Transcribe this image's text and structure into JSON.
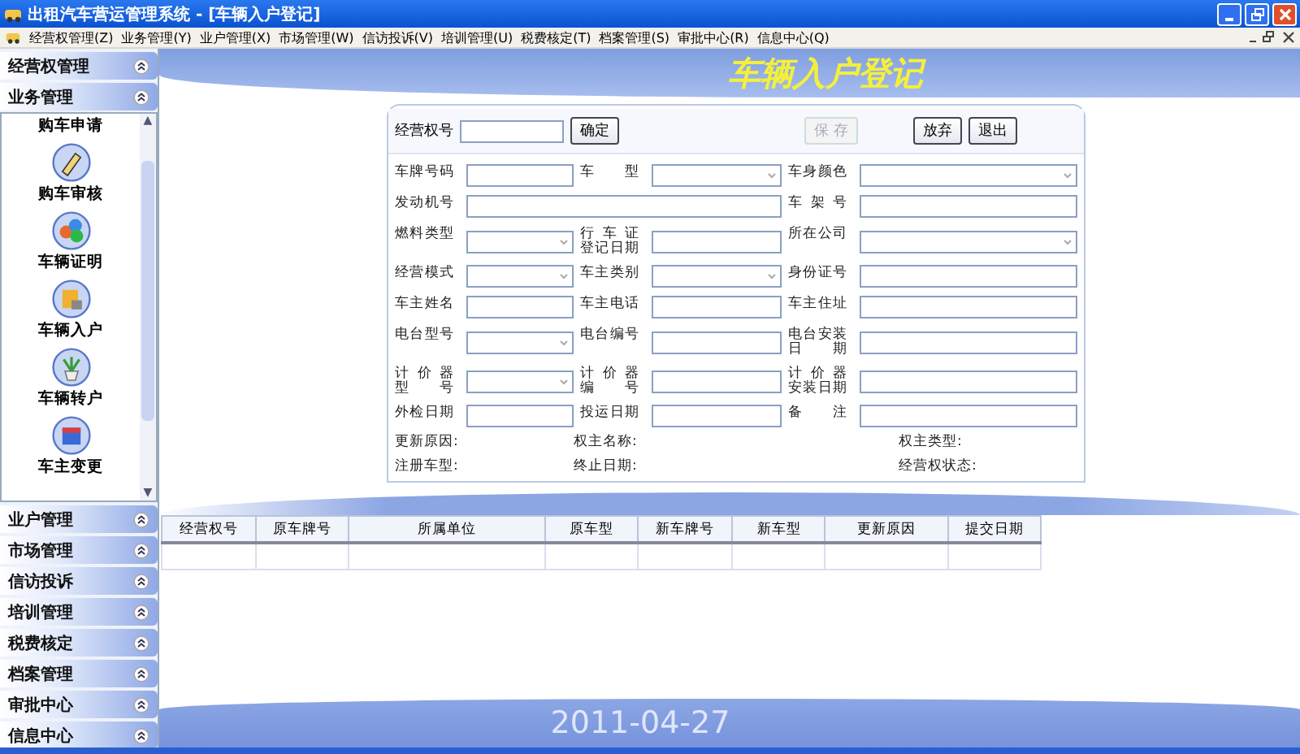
{
  "window": {
    "title": "出租汽车营运管理系统 - [车辆入户登记]"
  },
  "menu": [
    {
      "label": "经营权管理(Z)"
    },
    {
      "label": "业务管理(Y)"
    },
    {
      "label": "业户管理(X)"
    },
    {
      "label": "市场管理(W)"
    },
    {
      "label": "信访投诉(V)"
    },
    {
      "label": "培训管理(U)"
    },
    {
      "label": "税费核定(T)"
    },
    {
      "label": "档案管理(S)"
    },
    {
      "label": "审批中心(R)"
    },
    {
      "label": "信息中心(Q)"
    }
  ],
  "sidebar": {
    "top_groups": [
      "经营权管理",
      "业务管理"
    ],
    "items": [
      {
        "label": "购车申请"
      },
      {
        "label": "购车审核"
      },
      {
        "label": "车辆证明"
      },
      {
        "label": "车辆入户"
      },
      {
        "label": "车辆转户"
      },
      {
        "label": "车主变更"
      }
    ],
    "bottom_groups": [
      "业户管理",
      "市场管理",
      "信访投诉",
      "培训管理",
      "税费核定",
      "档案管理",
      "审批中心",
      "信息中心"
    ]
  },
  "page_title": "车辆入户登记",
  "toolbar": {
    "key_label": "经营权号",
    "buttons": [
      {
        "label": "确定",
        "disabled": false
      },
      {
        "label": "保 存",
        "disabled": true
      },
      {
        "label": "放弃",
        "disabled": false
      },
      {
        "label": "退出",
        "disabled": false
      }
    ]
  },
  "fields": [
    {
      "label": [
        "车牌号码"
      ],
      "kind": "text"
    },
    {
      "label": [
        "车 型"
      ],
      "kind": "select"
    },
    {
      "label": [
        "车身颜色"
      ],
      "kind": "select"
    },
    {
      "label": [
        "发动机号"
      ],
      "kind": "text",
      "wide": true
    },
    {
      "label": [
        "车 架 号"
      ],
      "kind": "text"
    },
    {
      "label": [
        "燃料类型"
      ],
      "kind": "select"
    },
    {
      "label": [
        "行 车 证",
        "登记日期"
      ],
      "kind": "text"
    },
    {
      "label": [
        "所在公司"
      ],
      "kind": "select"
    },
    {
      "label": [
        "经营模式"
      ],
      "kind": "select"
    },
    {
      "label": [
        "车主类别"
      ],
      "kind": "select"
    },
    {
      "label": [
        "身份证号"
      ],
      "kind": "text"
    },
    {
      "label": [
        "车主姓名"
      ],
      "kind": "text"
    },
    {
      "label": [
        "车主电话"
      ],
      "kind": "text"
    },
    {
      "label": [
        "车主住址"
      ],
      "kind": "text"
    },
    {
      "label": [
        "电台型号"
      ],
      "kind": "select"
    },
    {
      "label": [
        "电台编号"
      ],
      "kind": "text"
    },
    {
      "label": [
        "电台安装",
        "日 期"
      ],
      "kind": "text"
    },
    {
      "label": [
        "计 价 器",
        "型 号"
      ],
      "kind": "select"
    },
    {
      "label": [
        "计 价 器",
        "编 号"
      ],
      "kind": "text"
    },
    {
      "label": [
        "计 价 器",
        "安装日期"
      ],
      "kind": "text"
    },
    {
      "label": [
        "外检日期"
      ],
      "kind": "text"
    },
    {
      "label": [
        "投运日期"
      ],
      "kind": "text"
    },
    {
      "label": [
        "备 注"
      ],
      "kind": "text"
    }
  ],
  "scroll_arrows": [
    "▲",
    "▼"
  ],
  "info": [
    [
      "更新原因:",
      "权主名称:",
      "权主类型:"
    ],
    [
      "注册车型:",
      "终止日期:",
      "经营权状态:"
    ]
  ],
  "table": {
    "columns": [
      "经营权号",
      "原车牌号",
      "所属单位",
      "原车型",
      "新车牌号",
      "新车型",
      "更新原因",
      "提交日期"
    ]
  },
  "date": "2011-04-27"
}
